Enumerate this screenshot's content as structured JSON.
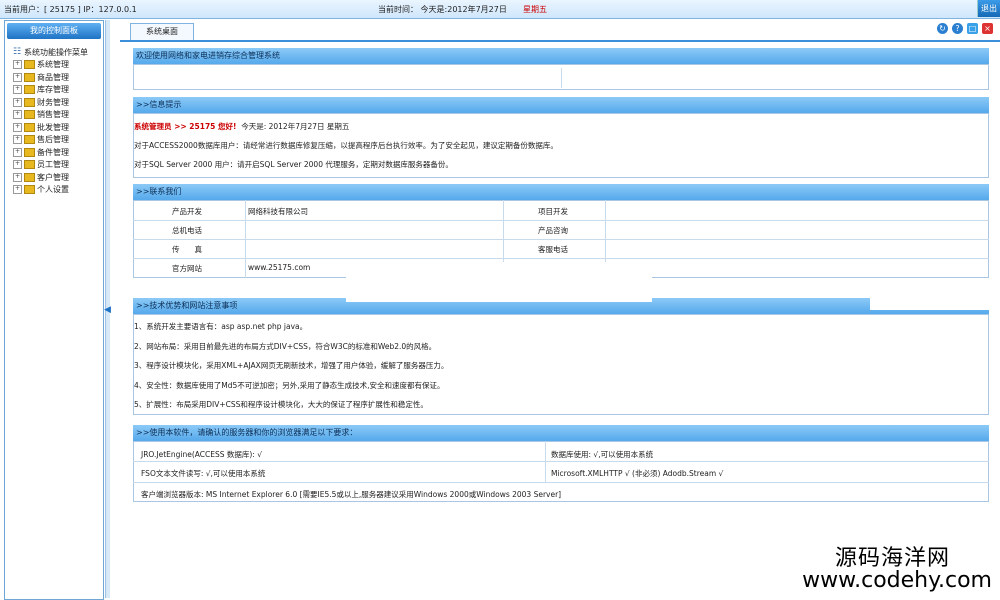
{
  "topbar": {
    "user_info": "当前用户：[ 25175 ]  IP：127.0.0.1",
    "time_label": "当前时间：  今天是:2012年7月27日",
    "weekday": "星期五",
    "logout_label": "退出"
  },
  "sidebar": {
    "title": "我的控制面板",
    "root_label": "系统功能操作菜单",
    "items": [
      {
        "label": "系统管理"
      },
      {
        "label": "商品管理"
      },
      {
        "label": "库存管理"
      },
      {
        "label": "财务管理"
      },
      {
        "label": "销售管理"
      },
      {
        "label": "批发管理"
      },
      {
        "label": "售后管理"
      },
      {
        "label": "备件管理"
      },
      {
        "label": "员工管理"
      },
      {
        "label": "客户管理"
      },
      {
        "label": "个人设置"
      }
    ]
  },
  "tabs": [
    {
      "label": "系统桌面"
    }
  ],
  "window_controls": [
    "refresh-icon",
    "help-icon",
    "restore-icon",
    "close-icon"
  ],
  "welcome": {
    "text": "欢迎使用网络和家电进销存综合管理系统"
  },
  "info": {
    "title": ">>信息提示",
    "greeting_role": "系统管理员 >> 25175 您好!",
    "greeting_date": "今天是: 2012年7月27日 星期五",
    "line1": "对于ACCESS2000数据库用户：请经常进行数据库修复压缩，以提高程序后台执行效率。为了安全起见，建议定期备份数据库。",
    "line2": "对于SQL Server 2000 用户：请开启SQL Server 2000 代理服务，定期对数据库服务器备份。"
  },
  "contact": {
    "title": ">>联系我们",
    "rows": [
      {
        "k1": "产品开发",
        "v1": "网络科技有限公司",
        "k2": "项目开发",
        "v2": ""
      },
      {
        "k1": "总机电话",
        "v1": "",
        "k2": "产品咨询",
        "v2": ""
      },
      {
        "k1": "传　　真",
        "v1": "",
        "k2": "客服电话",
        "v2": ""
      },
      {
        "k1": "官方网站",
        "v1": "www.25175.com",
        "k2": "",
        "v2": ""
      }
    ]
  },
  "tech": {
    "title": ">>技术优势和网站注意事项",
    "items": [
      "1、系统开发主要语言有：asp asp.net php java。",
      "2、网站布局：采用目前最先进的布局方式DIV+CSS，符合W3C的标准和Web2.0的风格。",
      "3、程序设计模块化，采用XML+AJAX网页无刷新技术，增强了用户体验，缓解了服务器压力。",
      "4、安全性：数据库使用了Md5不可逆加密；另外,采用了静态生成技术,安全和速度都有保证。",
      "5、扩展性：布局采用DIV+CSS和程序设计模块化，大大的保证了程序扩展性和稳定性。"
    ]
  },
  "requirements": {
    "title": ">>使用本软件，请确认的服务器和你的浏览器满足以下要求：",
    "r1_left": "JRO.JetEngine(ACCESS  数据库): √",
    "r1_right": "数据库使用: √,可以使用本系统",
    "r2_left": "FSO文本文件读写: √,可以使用本系统",
    "r2_right": "Microsoft.XMLHTTP √ (非必须)   Adodb.Stream √",
    "r3": "客户端浏览器版本: MS Internet Explorer 6.0 [需要IE5.5或以上,服务器建议采用Windows 2000或Windows 2003 Server]"
  },
  "watermark": {
    "line1": "源码海洋网",
    "line2": "www.codehy.com"
  },
  "colors": {
    "header_blue": "#55a9ec",
    "accent_red": "#c00000"
  }
}
